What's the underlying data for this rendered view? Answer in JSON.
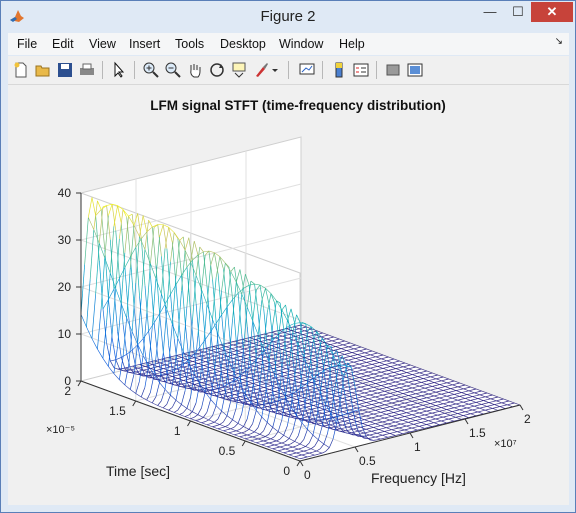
{
  "window": {
    "title": "Figure 2",
    "minimize": "—",
    "maximize": "☐",
    "close": "✕"
  },
  "menu": [
    "File",
    "Edit",
    "View",
    "Insert",
    "Tools",
    "Desktop",
    "Window",
    "Help"
  ],
  "toolbar": [
    "new-figure",
    "open-file",
    "save",
    "print",
    "edit-plot",
    "zoom-in",
    "zoom-out",
    "pan",
    "rotate-3d",
    "data-cursor",
    "brush",
    "link-plot",
    "colorbar",
    "legend",
    "hide-plot-tools",
    "show-plot-tools"
  ],
  "chart_data": {
    "type": "mesh3d",
    "title": "LFM signal STFT (time-frequency distribution)",
    "xlabel": "Frequency [Hz]",
    "ylabel": "Time [sec]",
    "zlabel": "",
    "x_ticks": [
      "0",
      "0.5",
      "1",
      "1.5",
      "2"
    ],
    "x_exponent": "×10⁷",
    "y_ticks": [
      "0",
      "0.5",
      "1",
      "1.5",
      "2"
    ],
    "y_exponent": "×10⁻⁵",
    "z_ticks": [
      "0",
      "10",
      "20",
      "30",
      "40"
    ],
    "xlim": [
      0,
      20000000
    ],
    "ylim": [
      0,
      2e-05
    ],
    "zlim": [
      0,
      40
    ],
    "ridge": {
      "description_points": [
        {
          "frequency": 1000000,
          "time": 1.95e-05,
          "magnitude": 38
        },
        {
          "frequency": 3000000,
          "time": 1.2e-05,
          "magnitude": 33
        },
        {
          "frequency": 4000000,
          "time": 1.5e-06,
          "magnitude": 18
        }
      ]
    },
    "colormap": "parula",
    "grid": true
  }
}
